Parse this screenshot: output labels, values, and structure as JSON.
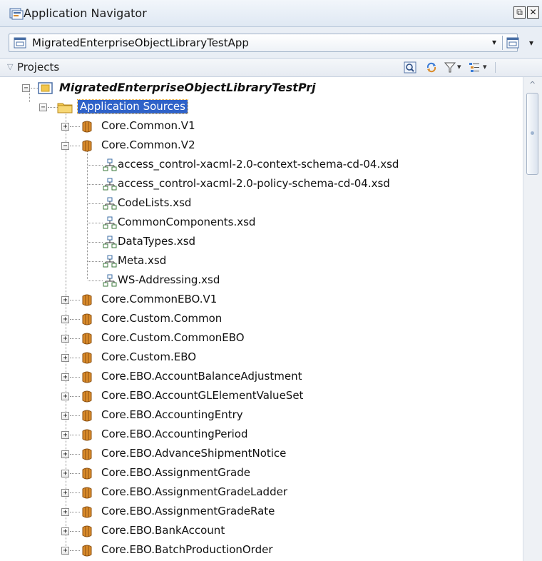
{
  "window": {
    "title": "Application Navigator",
    "icons": [
      "application-navigator-icon",
      "restore-icon",
      "close-icon"
    ],
    "restore_glyph": "⧉",
    "close_glyph": "✕"
  },
  "application_selector": {
    "value": "MigratedEnterpriseObjectLibraryTestApp",
    "dropdown_glyph": "▾",
    "menu_glyph": "▾"
  },
  "projects_panel": {
    "title": "Projects",
    "caret_glyph": "▽",
    "toolbar": [
      "search-icon",
      "sync-icon",
      "filter-icon",
      "layout-icon"
    ],
    "filter_arrow": "▾",
    "layout_arrow": "▾"
  },
  "tree": {
    "project": "MigratedEnterpriseObjectLibraryTestPrj",
    "app_sources": "Application Sources",
    "expanded_glyph": "−",
    "collapsed_glyph": "+",
    "packages_before": [
      "Core.Common.V1"
    ],
    "expanded_package": "Core.Common.V2",
    "schema_files": [
      "access_control-xacml-2.0-context-schema-cd-04.xsd",
      "access_control-xacml-2.0-policy-schema-cd-04.xsd",
      "CodeLists.xsd",
      "CommonComponents.xsd",
      "DataTypes.xsd",
      "Meta.xsd",
      "WS-Addressing.xsd"
    ],
    "packages_after": [
      "Core.CommonEBO.V1",
      "Core.Custom.Common",
      "Core.Custom.CommonEBO",
      "Core.Custom.EBO",
      "Core.EBO.AccountBalanceAdjustment",
      "Core.EBO.AccountGLElementValueSet",
      "Core.EBO.AccountingEntry",
      "Core.EBO.AccountingPeriod",
      "Core.EBO.AdvanceShipmentNotice",
      "Core.EBO.AssignmentGrade",
      "Core.EBO.AssignmentGradeLadder",
      "Core.EBO.AssignmentGradeRate",
      "Core.EBO.BankAccount",
      "Core.EBO.BatchProductionOrder"
    ]
  },
  "scrollbar": {
    "up_glyph": "^"
  },
  "colors": {
    "selection": "#2f62c8",
    "folder": "#f2c64d",
    "package": "#d98b2b",
    "schema": "#3b7a3b"
  }
}
